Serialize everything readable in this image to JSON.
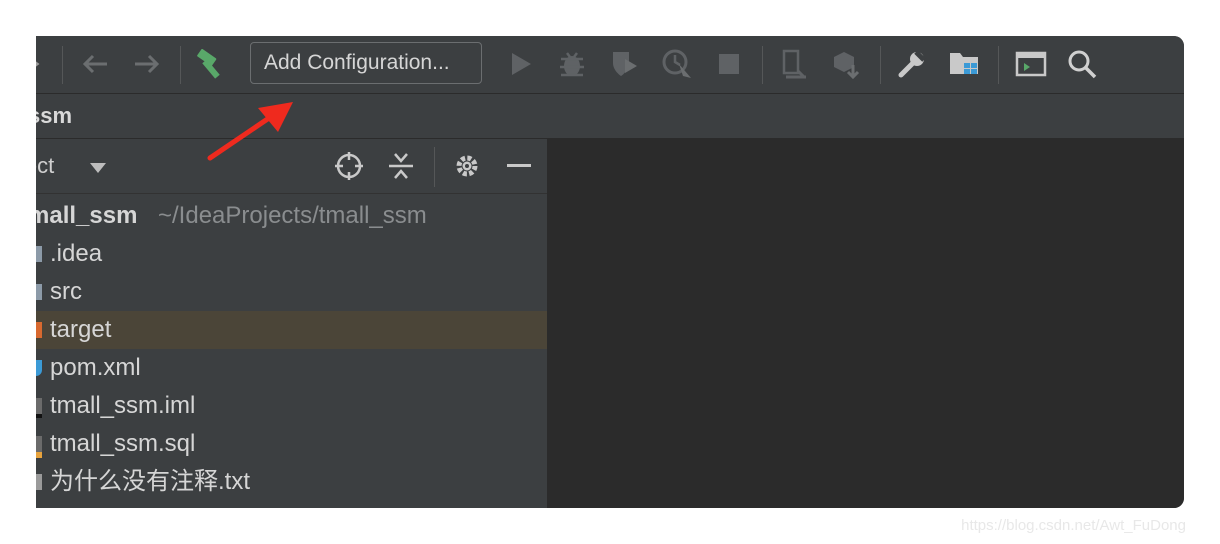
{
  "toolbar": {
    "config_label": "Add Configuration...",
    "icons": [
      "back-arrow-icon",
      "forward-arrow-icon",
      "build-hammer-icon",
      "run-icon",
      "debug-icon",
      "coverage-icon",
      "profile-icon",
      "stop-icon",
      "update-app-icon",
      "build-artifacts-icon",
      "settings-wrench-icon",
      "project-structure-icon",
      "terminal-window-icon",
      "search-icon"
    ],
    "accent_green": "#59a869"
  },
  "navbar": {
    "crumb": "ssm"
  },
  "project_panel": {
    "title": "ject",
    "tree": {
      "root": {
        "name": "mall_ssm",
        "path": "~/IdeaProjects/tmall_ssm"
      },
      "items": [
        {
          "label": ".idea",
          "color": "#8c9aa8"
        },
        {
          "label": "src",
          "color": "#8c9aa8"
        },
        {
          "label": "target",
          "color": "#d8692f",
          "selected": true
        },
        {
          "label": "pom.xml",
          "color": "#3b9ad6"
        },
        {
          "label": "tmall_ssm.iml",
          "color": "#777777"
        },
        {
          "label": "tmall_ssm.sql",
          "color": "#e8a33d"
        },
        {
          "label": "为什么没有注释.txt",
          "color": "#9a9a9a"
        }
      ]
    }
  },
  "watermark": "https://blog.csdn.net/Awt_FuDong",
  "annotation_color": "#ef2a1e"
}
